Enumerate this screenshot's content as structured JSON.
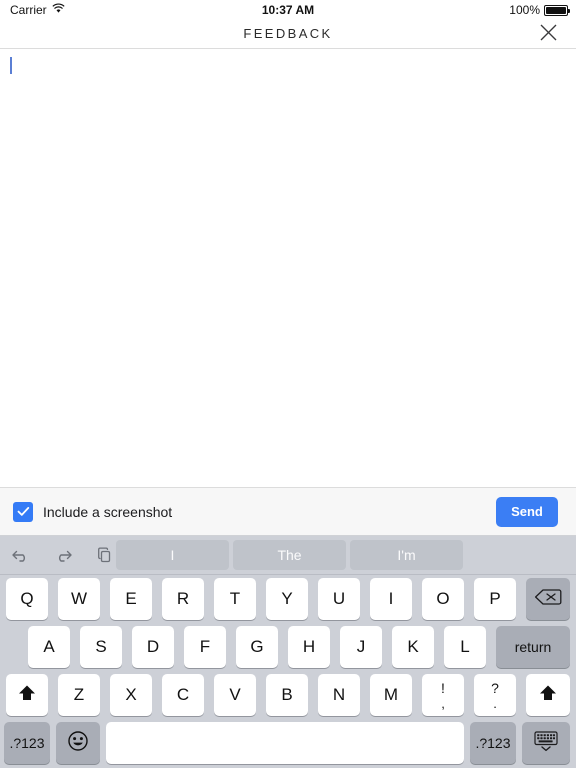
{
  "statusbar": {
    "carrier": "Carrier",
    "wifi_icon": "wifi-icon",
    "time": "10:37 AM",
    "battery_percent": "100%",
    "battery_icon": "battery-full-icon"
  },
  "navbar": {
    "title": "FEEDBACK",
    "close_icon": "close-icon"
  },
  "editor": {
    "value": "",
    "placeholder": "",
    "caret_visible": true
  },
  "actionbar": {
    "checkbox_checked": true,
    "checkbox_label": "Include a screenshot",
    "send_label": "Send",
    "send_color": "#3b7ef4",
    "checkbox_color": "#347bf6"
  },
  "keyboard": {
    "toolbar": [
      {
        "name": "undo-icon",
        "label": "undo"
      },
      {
        "name": "redo-icon",
        "label": "redo"
      },
      {
        "name": "paste-icon",
        "label": "paste"
      }
    ],
    "predictions": [
      "I",
      "The",
      "I'm"
    ],
    "row1": [
      "Q",
      "W",
      "E",
      "R",
      "T",
      "Y",
      "U",
      "I",
      "O",
      "P"
    ],
    "row1_action": {
      "label": "",
      "name": "backspace-key",
      "icon": "backspace-icon"
    },
    "row2": [
      "A",
      "S",
      "D",
      "F",
      "G",
      "H",
      "J",
      "K",
      "L"
    ],
    "row2_action": {
      "label": "return",
      "name": "return-key"
    },
    "row3": [
      "Z",
      "X",
      "C",
      "V",
      "B",
      "N",
      "M"
    ],
    "row3_shift_left": {
      "name": "shift-key-left",
      "icon": "shift-icon"
    },
    "row3_shift_right": {
      "name": "shift-key-right",
      "icon": "shift-icon"
    },
    "row3_punct1": {
      "top": "!",
      "bottom": ",",
      "name": "exclam-comma-key"
    },
    "row3_punct2": {
      "top": "?",
      "bottom": ".",
      "name": "question-period-key"
    },
    "row4": {
      "numeric_left": ".?123",
      "emoji_icon": "emoji-icon",
      "space_label": "",
      "numeric_right": ".?123",
      "dismiss_icon": "dismiss-keyboard-icon"
    },
    "bg_color": "#cdd0d7",
    "key_color": "#ffffff",
    "dark_key_color": "#a9adb6"
  }
}
